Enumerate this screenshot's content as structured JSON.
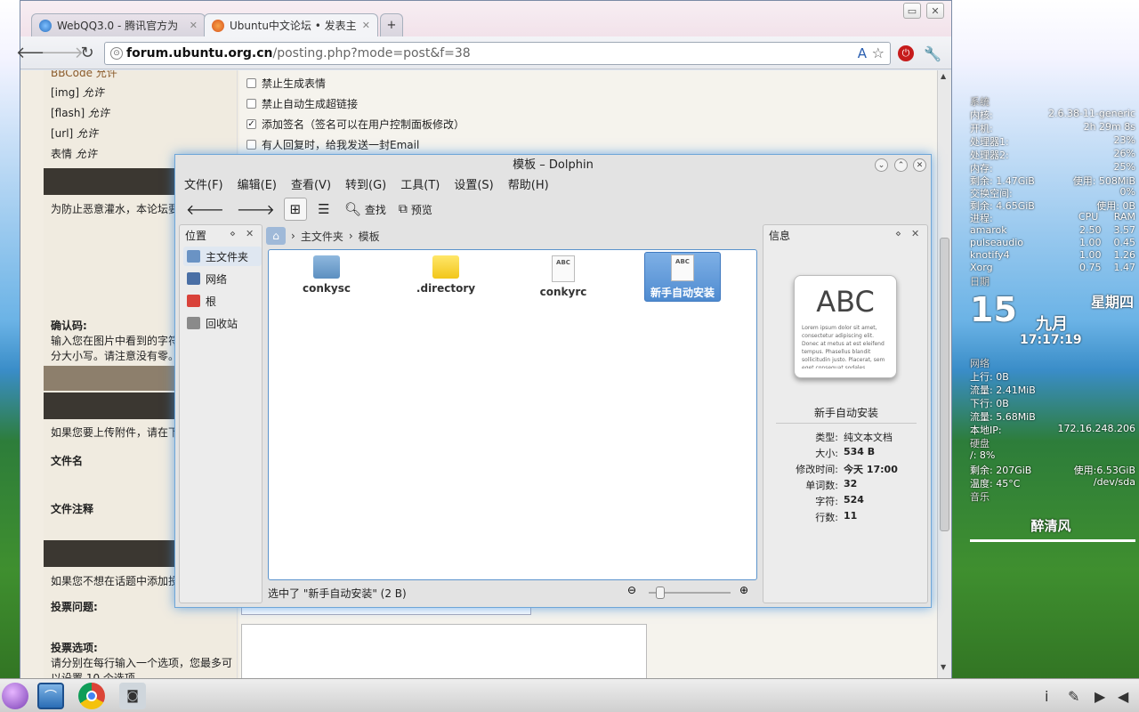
{
  "browser": {
    "tabs": [
      {
        "label": "WebQQ3.0 - 腾讯官方为"
      },
      {
        "label": "Ubuntu中文论坛 • 发表主"
      }
    ],
    "new_tab_label": "+",
    "url_host": "forum.ubuntu.org.cn",
    "url_path": "/posting.php?mode=post&f=38"
  },
  "page": {
    "left": {
      "bbcode": "BBCode 允许",
      "img": "[img]",
      "img_status": "允许",
      "flash": "[flash]",
      "flash_status": "允许",
      "url": "[url]",
      "url_status": "允许",
      "smilies": "表情",
      "smilies_status": "允许",
      "spam_notice": "为防止恶意灌水，本论坛要",
      "confirm_title": "确认码:",
      "confirm_text1": "输入您在图片中看到的字符",
      "confirm_text2": "分大小写。请注意没有零。",
      "attach_notice": "如果您要上传附件，请在下",
      "filename": "文件名",
      "filecomment": "文件注释",
      "poll_notice": "如果您不想在话题中添加投",
      "poll_question": "投票问题:",
      "poll_options": "投票选项:",
      "poll_options_text1": "请分别在每行输入一个选项，您最多可",
      "poll_options_text2": "以设置 10 个选项"
    },
    "options": [
      {
        "label": "禁止生成表情",
        "checked": false
      },
      {
        "label": "禁止自动生成超链接",
        "checked": false
      },
      {
        "label": "添加签名（签名可以在用户控制面板修改）",
        "checked": true
      },
      {
        "label": "有人回复时，给我发送一封Email",
        "checked": false
      }
    ]
  },
  "dolphin": {
    "title": "模板 – Dolphin",
    "menu": [
      "文件(F)",
      "编辑(E)",
      "查看(V)",
      "转到(G)",
      "工具(T)",
      "设置(S)",
      "帮助(H)"
    ],
    "find": "查找",
    "preview": "预览",
    "places_title": "位置",
    "places": [
      {
        "label": "主文件夹",
        "color": "#6a93c4"
      },
      {
        "label": "网络",
        "color": "#4a6fa5"
      },
      {
        "label": "根",
        "color": "#d9423a"
      },
      {
        "label": "回收站",
        "color": "#8a8a8a"
      }
    ],
    "breadcrumb": [
      "主文件夹",
      "模板"
    ],
    "files": [
      {
        "name": "conkysc",
        "kind": "folder",
        "color": "#6d9fcc"
      },
      {
        "name": ".directory",
        "kind": "folder",
        "color": "#f2d024"
      },
      {
        "name": "conkyrc",
        "kind": "doc",
        "badge": "ABC"
      },
      {
        "name": "新手自动安装",
        "kind": "doc",
        "badge": "ABC"
      }
    ],
    "status": "选中了 \"新手自动安装\" (2 B)",
    "info": {
      "title": "信息",
      "preview_text": "ABC",
      "preview_lorem": "Lorem ipsum dolor sit amet, consectetur adipiscing elit. Donec at metus at est eleifend tempus. Phasellus blandit sollicitudin justo. Placerat, sem eget consequat sodales.",
      "filename": "新手自动安装",
      "rows": [
        {
          "k": "类型:",
          "v": "纯文本文档"
        },
        {
          "k": "大小:",
          "v": "534 B"
        },
        {
          "k": "修改时间:",
          "v": "今天 17:00"
        },
        {
          "k": "单词数:",
          "v": "32"
        },
        {
          "k": "字符:",
          "v": "524"
        },
        {
          "k": "行数:",
          "v": "11"
        }
      ]
    }
  },
  "conky": {
    "system_label": "系统",
    "kernel_k": "内核:",
    "kernel_v": "2.6.38-11-generic",
    "uptime_k": "开机:",
    "uptime_v": "2h 29m 8s",
    "cpu1_k": "处理器1:",
    "cpu1_v": "23%",
    "cpu2_k": "处理器2:",
    "cpu2_v": "26%",
    "mem_k": "内存:",
    "mem_v": "25%",
    "memfree_k": "剩余: 1.47GiB",
    "memused_v": "使用: 508MiB",
    "swap_k": "交换空间:",
    "swap_v": "0%",
    "swapfree_k": "剩余: 4.65GiB",
    "swapused_v": "使用: 0B",
    "proc_k": "进程:",
    "proc_cpu": "CPU",
    "proc_ram": "RAM",
    "procs": [
      {
        "name": "amarok",
        "cpu": "2.50",
        "ram": "3.57"
      },
      {
        "name": "pulseaudio",
        "cpu": "1.00",
        "ram": "0.45"
      },
      {
        "name": "knotify4",
        "cpu": "1.00",
        "ram": "1.26"
      },
      {
        "name": "Xorg",
        "cpu": "0.75",
        "ram": "1.47"
      }
    ],
    "date_label": "日期",
    "day": "15",
    "weekday": "星期四",
    "month": "九月",
    "time": "17:17:19",
    "net_label": "网络",
    "up_k": "上行: 0B",
    "up_total": "流量: 2.41MiB",
    "down_k": "下行: 0B",
    "down_total": "流量: 5.68MiB",
    "ip_k": "本地IP:",
    "ip_v": "172.16.248.206",
    "disk_label": "硬盘",
    "disk_root": "/: 8%",
    "disk_free": "剩余: 207GiB",
    "disk_used": "使用:6.53GiB",
    "temp_k": "温度: 45°C",
    "temp_v": "/dev/sda",
    "music_label": "音乐",
    "user": "醉清风"
  }
}
